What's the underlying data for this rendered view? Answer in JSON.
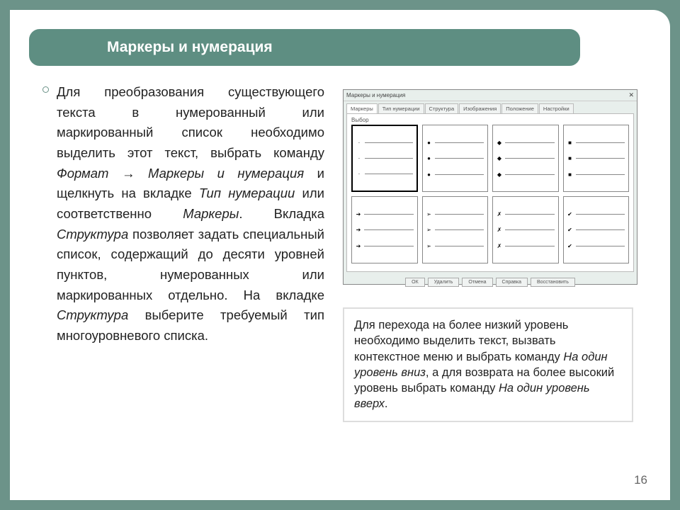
{
  "title": "Маркеры и нумерация",
  "body_html": "Для преобразования существующего текста в нумерованный или маркированный список необходимо выделить этот текст, выбрать команду <i>Формат → Маркеры и нумерация</i> и щелкнуть на вкладке <i>Тип нумерации</i> или соответственно <i>Маркеры</i>. Вкладка <i>Структура</i> позволяет задать специальный список, содержащий до десяти уровней пунктов, нумерованных или маркированных отдельно. На вкладке <i>Структура</i> выберите требуемый тип многоуровневого списка.",
  "sidebox_html": "Для перехода на более низкий уровень необходимо выделить текст, вызвать контекстное меню и выбрать команду <i>На один уровень вниз</i>, а для возврата на более высокий уровень выбрать команду <i>На один уровень вверх</i>.",
  "page_number": "16",
  "dialog": {
    "title": "Маркеры и нумерация",
    "tabs": [
      "Маркеры",
      "Тип нумерации",
      "Структура",
      "Изображения",
      "Положение",
      "Настройки"
    ],
    "label": "Выбор",
    "bullet_cells": [
      {
        "marker": "·",
        "selected": true
      },
      {
        "marker": "●",
        "selected": false
      },
      {
        "marker": "◆",
        "selected": false
      },
      {
        "marker": "■",
        "selected": false
      },
      {
        "marker": "➔",
        "selected": false
      },
      {
        "marker": "➢",
        "selected": false
      },
      {
        "marker": "✗",
        "selected": false
      },
      {
        "marker": "✔",
        "selected": false
      }
    ],
    "buttons": [
      "ОК",
      "Удалить",
      "Отмена",
      "Справка",
      "Восстановить"
    ]
  }
}
